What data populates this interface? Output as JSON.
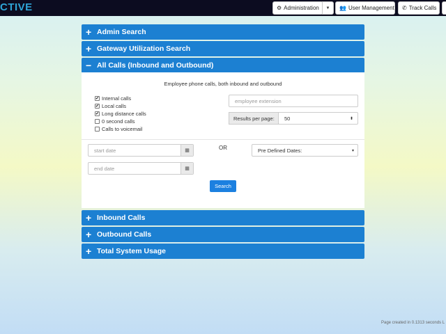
{
  "header": {
    "brand": "CTIVE",
    "admin_label": "Administration",
    "user_mgmt_label": "User Management",
    "track_calls_label": "Track Calls"
  },
  "panels": {
    "admin_search": "Admin Search",
    "gateway_search": "Gateway Utilization Search",
    "all_calls": "All Calls (Inbound and Outbound)",
    "inbound": "Inbound Calls",
    "outbound": "Outbound Calls",
    "total_usage": "Total System Usage"
  },
  "all_calls_form": {
    "description": "Employee phone calls, both inbound and outbound",
    "checkboxes": [
      {
        "label": "Internal calls",
        "checked": true
      },
      {
        "label": "Local calls",
        "checked": true
      },
      {
        "label": "Long distance calls",
        "checked": true
      },
      {
        "label": "0 second calls",
        "checked": false
      },
      {
        "label": "Calls to voicemail",
        "checked": false
      }
    ],
    "extension_placeholder": "employee extension",
    "results_label": "Results per page:",
    "results_value": "50",
    "start_date_placeholder": "start date",
    "end_date_placeholder": "end date",
    "or_label": "OR",
    "predefined_dates": "Pre Defined Dates:",
    "search_button": "Search"
  },
  "footer": {
    "text": "Page created in 0.1313 seconds L"
  },
  "colors": {
    "panel_blue": "#1c80d2",
    "topbar": "#0c0c20",
    "brand": "#2fa6d8"
  }
}
